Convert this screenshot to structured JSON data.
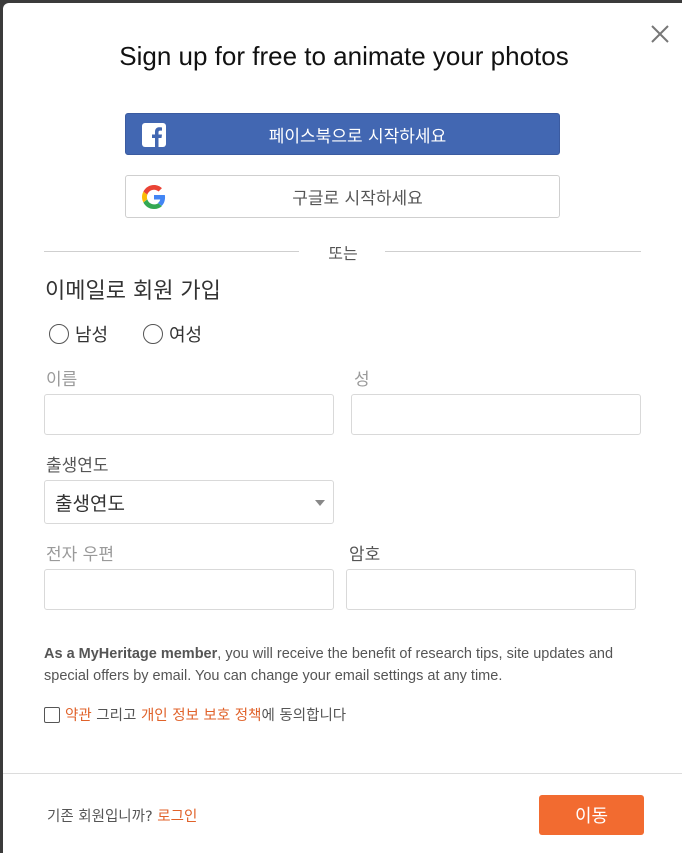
{
  "modal": {
    "title": "Sign up for free to animate your photos"
  },
  "social": {
    "facebook_label": "페이스북으로 시작하세요",
    "google_label": "구글로 시작하세요",
    "facebook_color": "#4267b2"
  },
  "divider": {
    "text": "또는"
  },
  "email_signup": {
    "title": "이메일로 회원 가입",
    "gender_options": [
      "남성",
      "여성"
    ],
    "first_name_label": "이름",
    "last_name_label": "성",
    "birth_year_label": "출생연도",
    "birth_year_value": "출생연도",
    "zip_label": "전자 우편",
    "password_label": "암호"
  },
  "notice": {
    "bold": "As a MyHeritage member",
    "text": ", you will receive the benefit of research tips, site updates and special offers by email. You can change your email settings at any time."
  },
  "agreement": {
    "terms_link": "약관",
    "and": " 그리고 ",
    "privacy_link": "개인 정보 보호 정책",
    "suffix": "에 동의합니다"
  },
  "footer": {
    "existing_member": "기존 회원입니까? ",
    "login_link": "로그인",
    "submit_label": "이동",
    "accent_color": "#f26b30"
  }
}
